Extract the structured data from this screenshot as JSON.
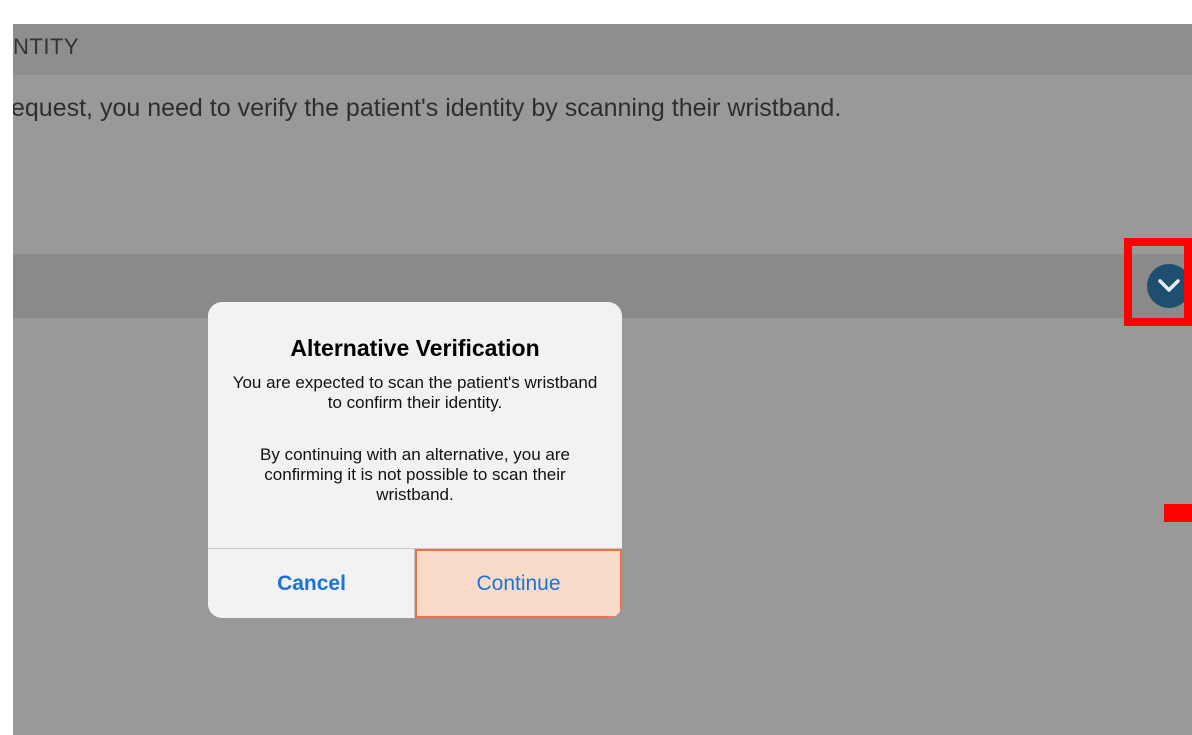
{
  "section": {
    "header_label": "NTITY"
  },
  "instruction": {
    "text": "equest, you need to verify the patient's identity by scanning their wristband."
  },
  "row": {
    "expand_icon": "chevron-down-circle-icon"
  },
  "dialog": {
    "title": "Alternative Verification",
    "message_1": "You are expected to scan the patient's wristband to confirm their identity.",
    "message_2": "By continuing with an alternative, you are confirming it is not possible to scan their wristband.",
    "cancel_label": "Cancel",
    "continue_label": "Continue"
  },
  "colors": {
    "overlay": "#999999",
    "accent_blue": "#1a73d9",
    "icon_circle": "#1d4f6e",
    "highlight_red": "#ff0000",
    "continue_highlight_fill": "#f8dcc9",
    "continue_highlight_border": "#e8734a"
  }
}
